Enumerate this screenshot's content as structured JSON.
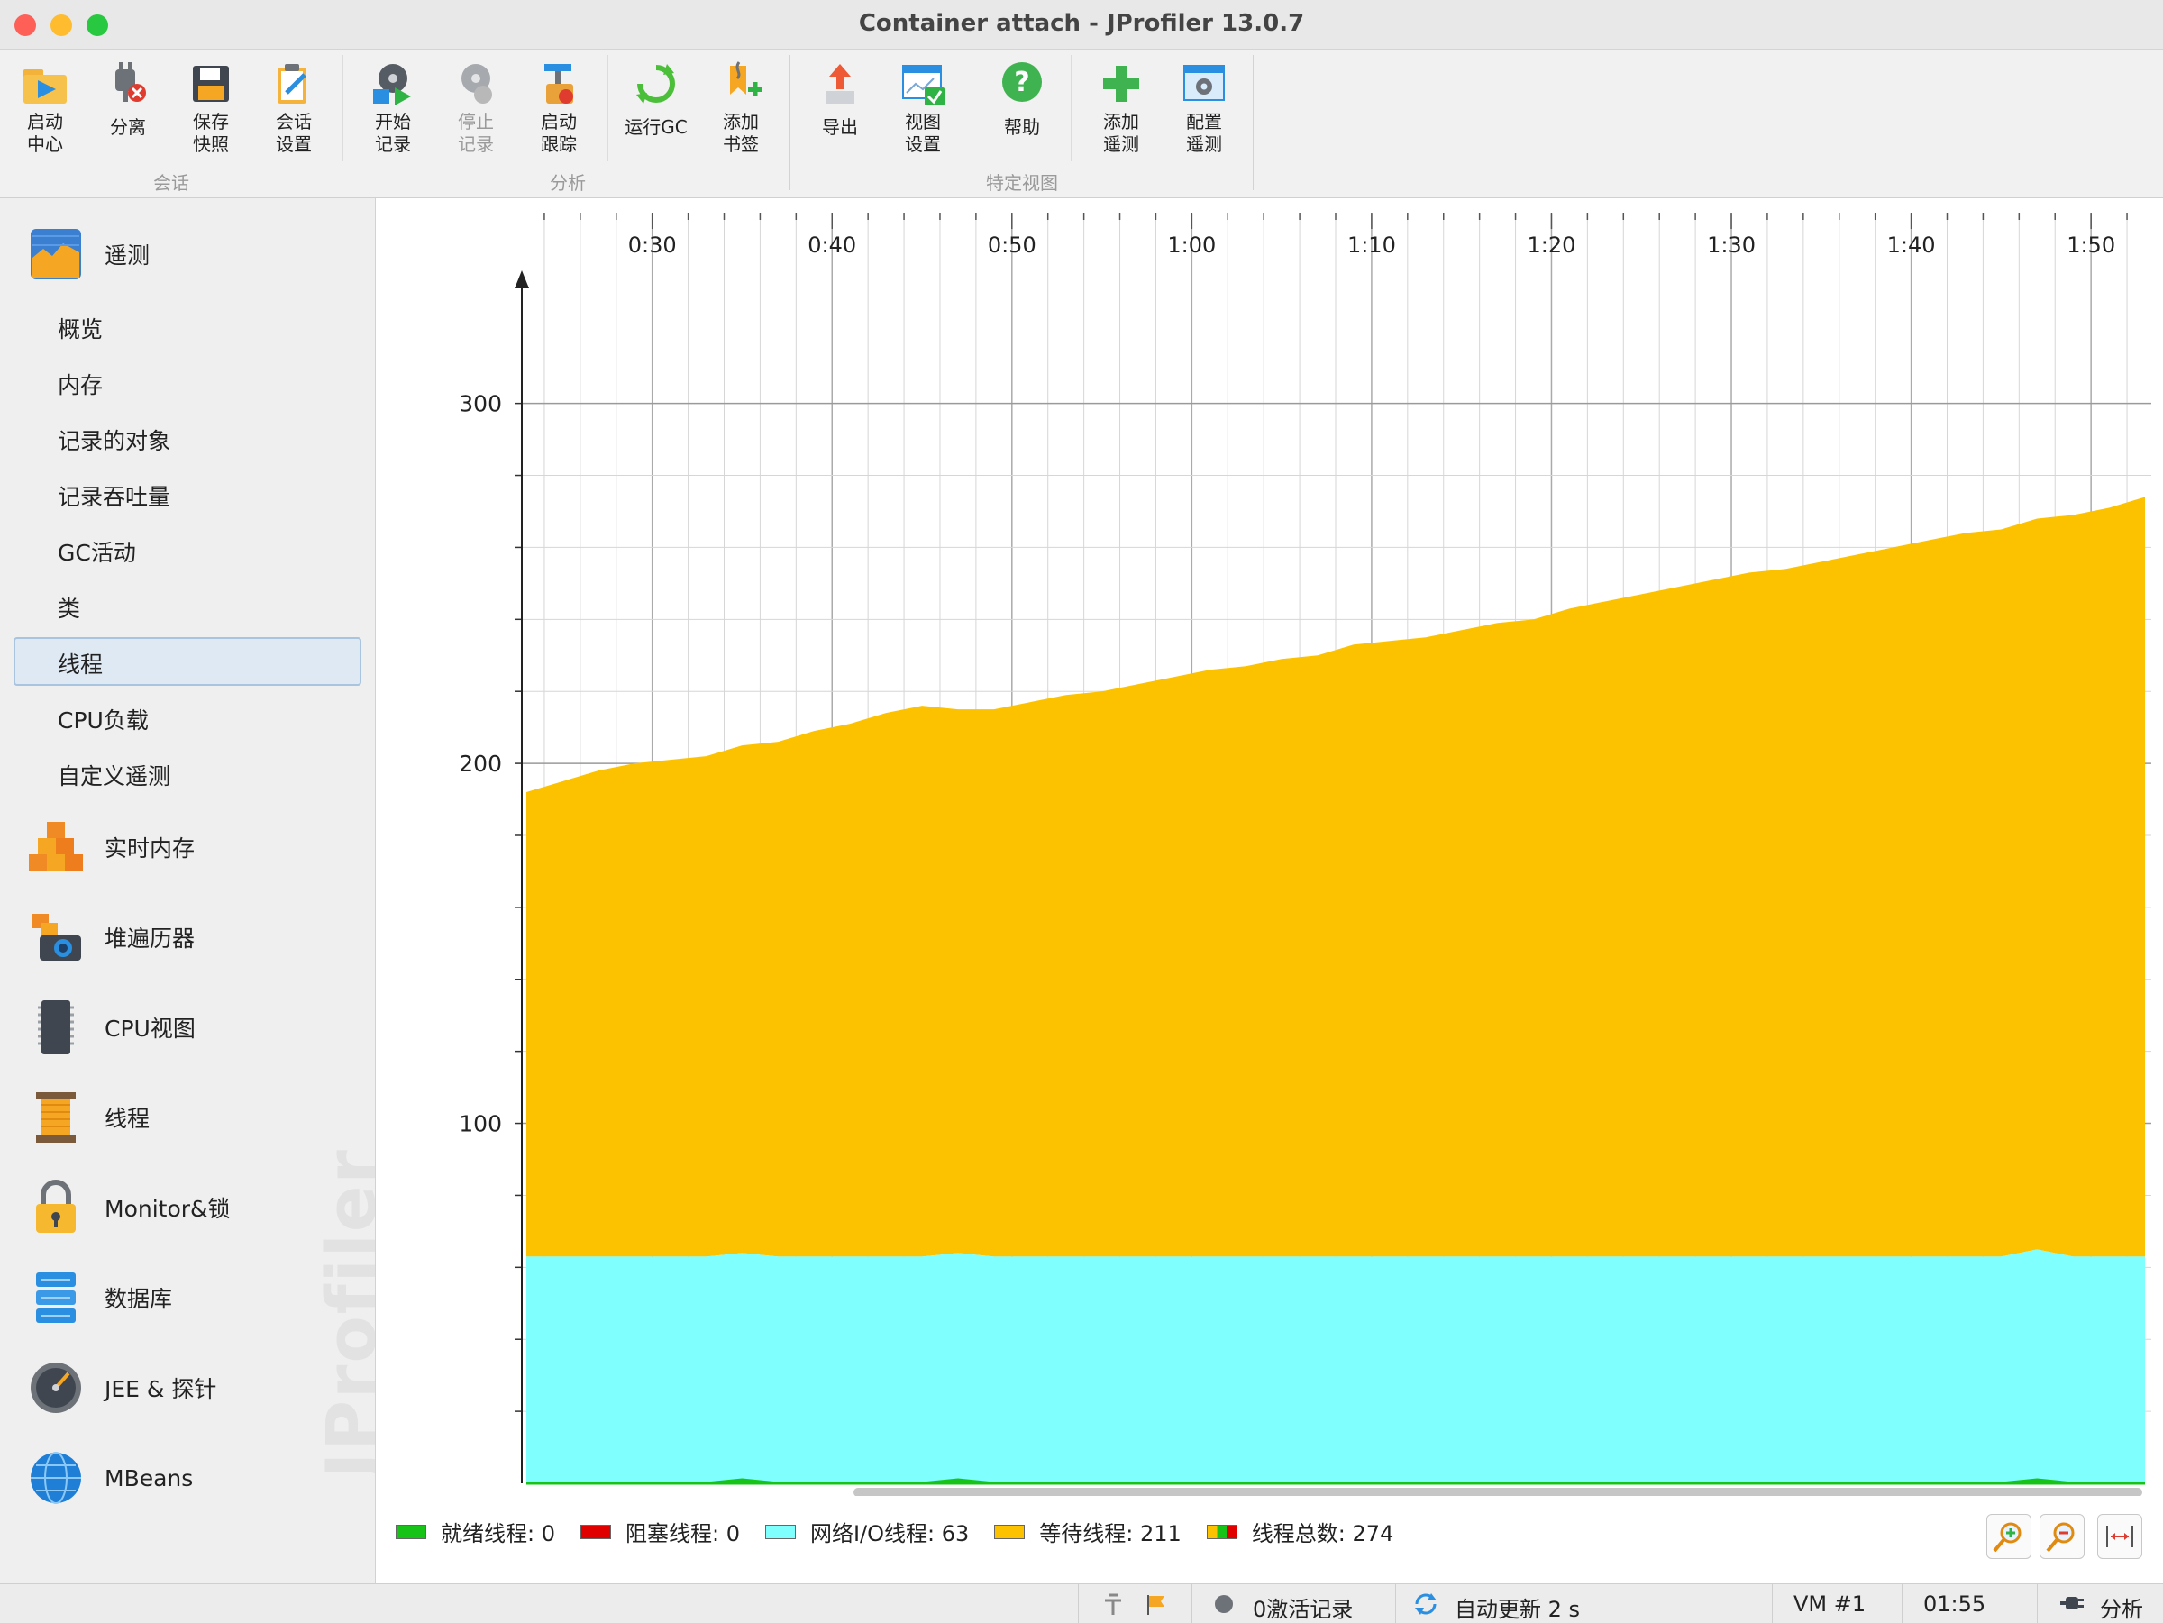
{
  "window": {
    "title": "Container attach - JProfiler 13.0.7"
  },
  "toolbar": {
    "groups": {
      "session": "会话",
      "analysis": "分析",
      "special": "特定视图"
    },
    "start_center": "启动\n中心",
    "detach": "分离",
    "save_snapshot": "保存\n快照",
    "session_settings": "会话\n设置",
    "start_recording": "开始\n记录",
    "stop_recording": "停止\n记录",
    "start_tracking": "启动\n跟踪",
    "run_gc": "运行GC",
    "add_bookmark": "添加\n书签",
    "export": "导出",
    "view_settings": "视图\n设置",
    "help": "帮助",
    "add_telemetry": "添加\n遥测",
    "configure_telemetry": "配置\n遥测"
  },
  "sidebar": {
    "telemetry": "遥测",
    "telemetry_items": [
      "概览",
      "内存",
      "记录的对象",
      "记录吞吐量",
      "GC活动",
      "类",
      "线程",
      "CPU负载",
      "自定义遥测"
    ],
    "selected_item": "线程",
    "sections": [
      "实时内存",
      "堆遍历器",
      "CPU视图",
      "线程",
      "Monitor&锁",
      "数据库",
      "JEE & 探针",
      "MBeans"
    ],
    "watermark": "JProfiler"
  },
  "legend": {
    "runnable": "就绪线程:  0",
    "blocked": "阻塞线程:  0",
    "net_io": "网络I/O线程:  63",
    "waiting": "等待线程:  211",
    "total": "线程总数:  274"
  },
  "status": {
    "recordings": "0激活记录",
    "auto_update": "自动更新 2 s",
    "vm": "VM #1",
    "time": "01:55",
    "mode": "分析"
  },
  "colors": {
    "runnable": "#18c318",
    "blocked": "#e00000",
    "net_io": "#80ffff",
    "waiting": "#fcc200"
  },
  "chart_data": {
    "type": "area",
    "stacked": true,
    "x_unit": "m:ss",
    "x_ticks": [
      "0:30",
      "0:40",
      "0:50",
      "1:00",
      "1:10",
      "1:20",
      "1:30",
      "1:40",
      "1:50"
    ],
    "x_tick_seconds": [
      30,
      40,
      50,
      60,
      70,
      80,
      90,
      100,
      110
    ],
    "x_range_seconds": [
      22.8,
      113.2
    ],
    "y_ticks": [
      "100",
      "200",
      "300"
    ],
    "y_tick_values": [
      100,
      200,
      300
    ],
    "ylim": [
      0,
      300
    ],
    "x_seconds": [
      23,
      25,
      27,
      29,
      31,
      33,
      35,
      37,
      39,
      41,
      43,
      45,
      47,
      49,
      51,
      53,
      55,
      57,
      59,
      61,
      63,
      65,
      67,
      69,
      71,
      73,
      75,
      77,
      79,
      81,
      83,
      85,
      87,
      89,
      91,
      93,
      95,
      97,
      99,
      101,
      103,
      105,
      107,
      109,
      111,
      113
    ],
    "series": [
      {
        "name": "就绪线程",
        "key": "runnable",
        "values": [
          0,
          0,
          0,
          0,
          0,
          0,
          1,
          0,
          0,
          0,
          0,
          0,
          1,
          0,
          0,
          0,
          0,
          0,
          0,
          0,
          0,
          0,
          0,
          0,
          0,
          0,
          0,
          0,
          0,
          0,
          0,
          0,
          0,
          0,
          0,
          0,
          0,
          0,
          0,
          0,
          0,
          0,
          1,
          0,
          0,
          0
        ]
      },
      {
        "name": "阻塞线程",
        "key": "blocked",
        "values": [
          0,
          0,
          0,
          0,
          0,
          0,
          0,
          0,
          0,
          0,
          0,
          0,
          0,
          0,
          0,
          0,
          0,
          0,
          0,
          0,
          0,
          0,
          0,
          0,
          0,
          0,
          0,
          0,
          0,
          0,
          0,
          0,
          0,
          0,
          0,
          0,
          0,
          0,
          0,
          0,
          0,
          0,
          0,
          0,
          0,
          0
        ]
      },
      {
        "name": "网络I/O线程",
        "key": "net_io",
        "values": [
          63,
          63,
          63,
          63,
          63,
          63,
          63,
          63,
          63,
          63,
          63,
          63,
          63,
          63,
          63,
          63,
          63,
          63,
          63,
          63,
          63,
          63,
          63,
          63,
          63,
          63,
          63,
          63,
          63,
          63,
          63,
          63,
          63,
          63,
          63,
          63,
          63,
          63,
          63,
          63,
          63,
          63,
          64,
          63,
          63,
          63
        ]
      },
      {
        "name": "等待线程",
        "key": "waiting",
        "values": [
          129,
          132,
          135,
          137,
          138,
          139,
          141,
          143,
          146,
          148,
          151,
          153,
          151,
          152,
          154,
          156,
          157,
          159,
          161,
          163,
          164,
          166,
          167,
          170,
          171,
          172,
          174,
          176,
          177,
          180,
          182,
          184,
          186,
          188,
          190,
          191,
          193,
          195,
          197,
          199,
          201,
          202,
          203,
          206,
          208,
          211
        ]
      }
    ]
  }
}
